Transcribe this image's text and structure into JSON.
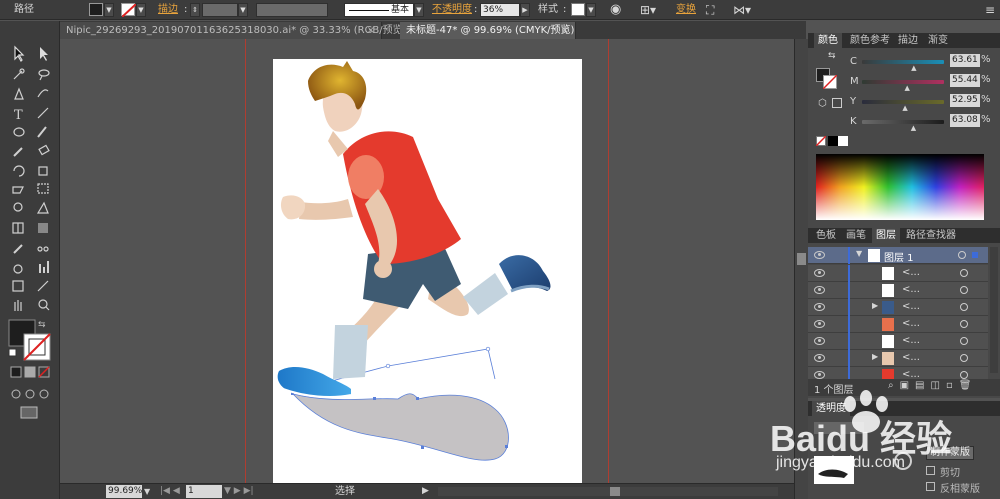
{
  "control_bar": {
    "object_type": "路径",
    "stroke_label": "描边",
    "brush_value": "基本",
    "opacity_label": "不透明度",
    "opacity_value": "36%",
    "style_label": "样式",
    "transform_label": "变换"
  },
  "tabs": [
    {
      "label": "Nipic_29269293_20190701163625318030.ai* @ 33.33% (RGB/预览)",
      "active": false
    },
    {
      "label": "未标题-47* @ 99.69% (CMYK/预览)",
      "active": true
    }
  ],
  "color_panel": {
    "tabs": [
      "颜色",
      "颜色参考",
      "描边",
      "渐变"
    ],
    "channels": [
      {
        "label": "C",
        "value": "63.61",
        "fraction": 0.6361
      },
      {
        "label": "M",
        "value": "55.44",
        "fraction": 0.5544
      },
      {
        "label": "Y",
        "value": "52.95",
        "fraction": 0.5295
      },
      {
        "label": "K",
        "value": "63.08",
        "fraction": 0.6308
      }
    ]
  },
  "layers_panel": {
    "tabs": [
      "色板",
      "画笔",
      "图层",
      "路径查找器"
    ],
    "layer_name": "图层 1",
    "sublayer_label": "<...",
    "sublayer_count": 7,
    "footer_count": "1 个图层"
  },
  "transparency_panel": {
    "tab": "透明度",
    "make_mask_label": "制作蒙版",
    "clip_label": "剪切",
    "invert_label": "反相蒙版"
  },
  "status_bar": {
    "zoom": "99.69%",
    "page": "1",
    "tool": "选择"
  },
  "watermark": {
    "brand": "Baidu 经验",
    "url": "jingyan.baidu.com"
  }
}
